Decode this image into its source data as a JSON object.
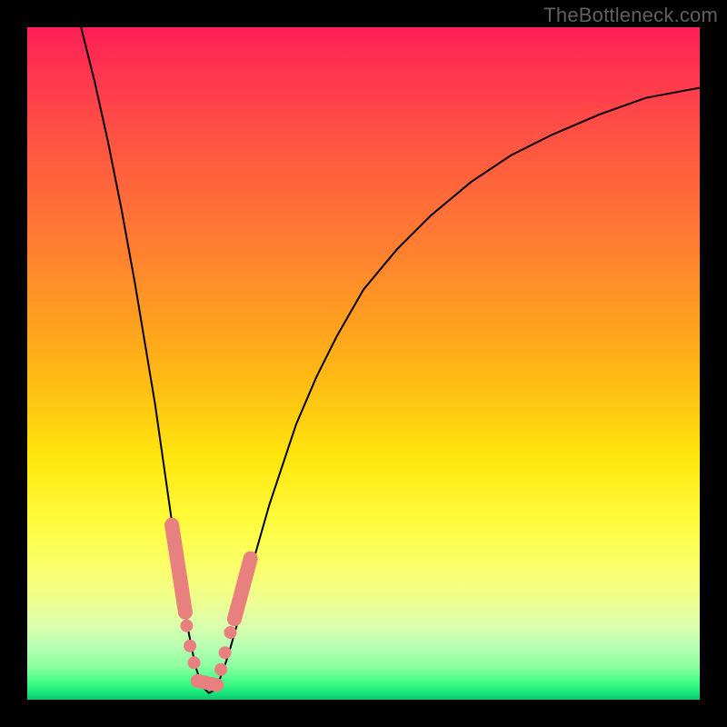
{
  "watermark": "TheBottleneck.com",
  "chart_data": {
    "type": "line",
    "title": "",
    "xlabel": "",
    "ylabel": "",
    "xlim": [
      0,
      100
    ],
    "ylim": [
      0,
      100
    ],
    "grid": false,
    "curve": {
      "x": [
        8,
        10,
        12,
        14,
        16,
        18,
        19,
        20,
        21,
        22,
        23,
        24,
        25,
        26,
        27,
        28,
        29,
        30,
        32,
        34,
        36,
        38,
        40,
        43,
        46,
        50,
        55,
        60,
        66,
        72,
        78,
        85,
        92,
        100
      ],
      "y": [
        100,
        92,
        83,
        73,
        62,
        50,
        44,
        37,
        30,
        23,
        16,
        10,
        5,
        2,
        1,
        1.5,
        4,
        7,
        14,
        22,
        29,
        35,
        41,
        48,
        54,
        61,
        67,
        72,
        77,
        81,
        84,
        87,
        89.5,
        91
      ]
    },
    "markers": {
      "left_band": {
        "x_from": 21.5,
        "x_to": 23.5,
        "y_from": 26,
        "y_to": 13
      },
      "left_dots": [
        {
          "x": 23.7,
          "y": 11
        },
        {
          "x": 24.2,
          "y": 8
        },
        {
          "x": 24.8,
          "y": 5.5
        }
      ],
      "bottom_band": {
        "x_from": 25.3,
        "x_to": 28.2,
        "y_from": 2.8,
        "y_to": 2.2
      },
      "right_dots": [
        {
          "x": 28.8,
          "y": 4.5
        },
        {
          "x": 29.4,
          "y": 7
        },
        {
          "x": 30.2,
          "y": 10
        }
      ],
      "right_band": {
        "x_from": 30.8,
        "x_to": 33.2,
        "y_from": 12,
        "y_to": 21
      }
    }
  }
}
